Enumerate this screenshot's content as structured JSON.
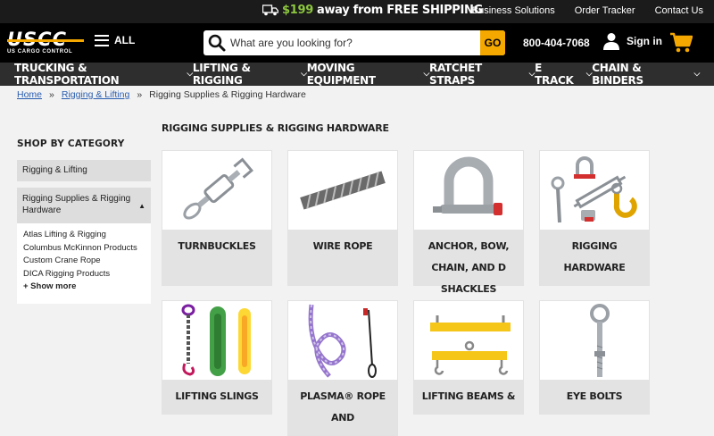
{
  "topbar": {
    "ship_amount": "$199",
    "ship_text": "away from FREE SHIPPING",
    "links": [
      "Business Solutions",
      "Order Tracker",
      "Contact Us"
    ]
  },
  "header": {
    "logo_text": "USCC",
    "logo_sub": "US CARGO CONTROL",
    "all_label": "ALL",
    "search_placeholder": "What are you looking for?",
    "go_label": "GO",
    "phone": "800-404-7068",
    "signin_label": "Sign in"
  },
  "nav": [
    "TRUCKING & TRANSPORTATION",
    "LIFTING & RIGGING",
    "MOVING EQUIPMENT",
    "RATCHET STRAPS",
    "E TRACK",
    "CHAIN & BINDERS"
  ],
  "breadcrumb": {
    "home": "Home",
    "parent": "Rigging & Lifting",
    "current": "Rigging Supplies & Rigging Hardware",
    "sep": "»"
  },
  "sidebar": {
    "heading": "SHOP BY CATEGORY",
    "item1": "Rigging & Lifting",
    "item2": "Rigging Supplies & Rigging Hardware",
    "subitems": [
      "Atlas Lifting & Rigging",
      "Columbus McKinnon Products",
      "Custom Crane Rope",
      "DICA Rigging Products"
    ],
    "show_more": "+ Show more"
  },
  "page_title": "RIGGING SUPPLIES & RIGGING HARDWARE",
  "categories": [
    {
      "label": "TURNBUCKLES",
      "icon": "turnbuckle-image"
    },
    {
      "label": "WIRE ROPE",
      "icon": "wire-rope-image"
    },
    {
      "label": "ANCHOR, BOW, CHAIN, AND D SHACKLES",
      "icon": "shackle-image"
    },
    {
      "label": "RIGGING HARDWARE",
      "icon": "rigging-hardware-image"
    },
    {
      "label": "LIFTING SLINGS",
      "icon": "lifting-slings-image"
    },
    {
      "label": "PLASMA® ROPE AND",
      "icon": "plasma-rope-image"
    },
    {
      "label": "LIFTING BEAMS &",
      "icon": "lifting-beams-image"
    },
    {
      "label": "EYE BOLTS",
      "icon": "eye-bolt-image"
    }
  ],
  "colors": {
    "accent": "#f5a800",
    "green": "#8cc63f",
    "nav_bg": "#2e2e2e",
    "link": "#2a5db0"
  }
}
